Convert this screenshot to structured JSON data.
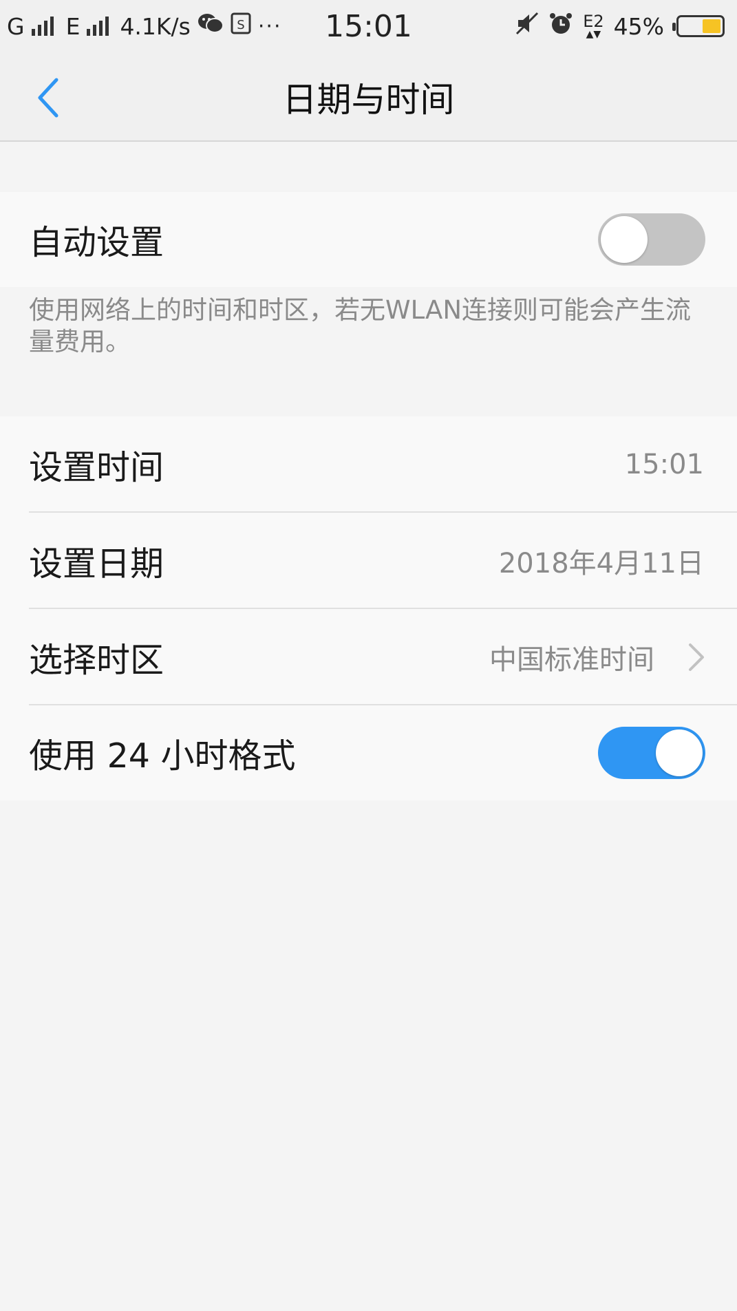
{
  "status_bar": {
    "carrier1": "G",
    "carrier2": "E",
    "speed": "4.1K/s",
    "more": "···",
    "time": "15:01",
    "battery_pct": "45%",
    "network_badge": "E2",
    "battery_color": "#f6c324"
  },
  "header": {
    "title": "日期与时间"
  },
  "auto_section": {
    "label": "自动设置",
    "enabled": false,
    "description": "使用网络上的时间和时区，若无WLAN连接则可能会产生流量费用。"
  },
  "settings": {
    "set_time": {
      "label": "设置时间",
      "value": "15:01"
    },
    "set_date": {
      "label": "设置日期",
      "value": "2018年4月11日"
    },
    "timezone": {
      "label": "选择时区",
      "value": "中国标准时间"
    },
    "format24": {
      "label": "使用 24 小时格式",
      "enabled": true
    }
  },
  "colors": {
    "accent": "#2f96f3",
    "toggle_off": "#c4c4c4",
    "secondary_text": "#8a8a8a"
  }
}
